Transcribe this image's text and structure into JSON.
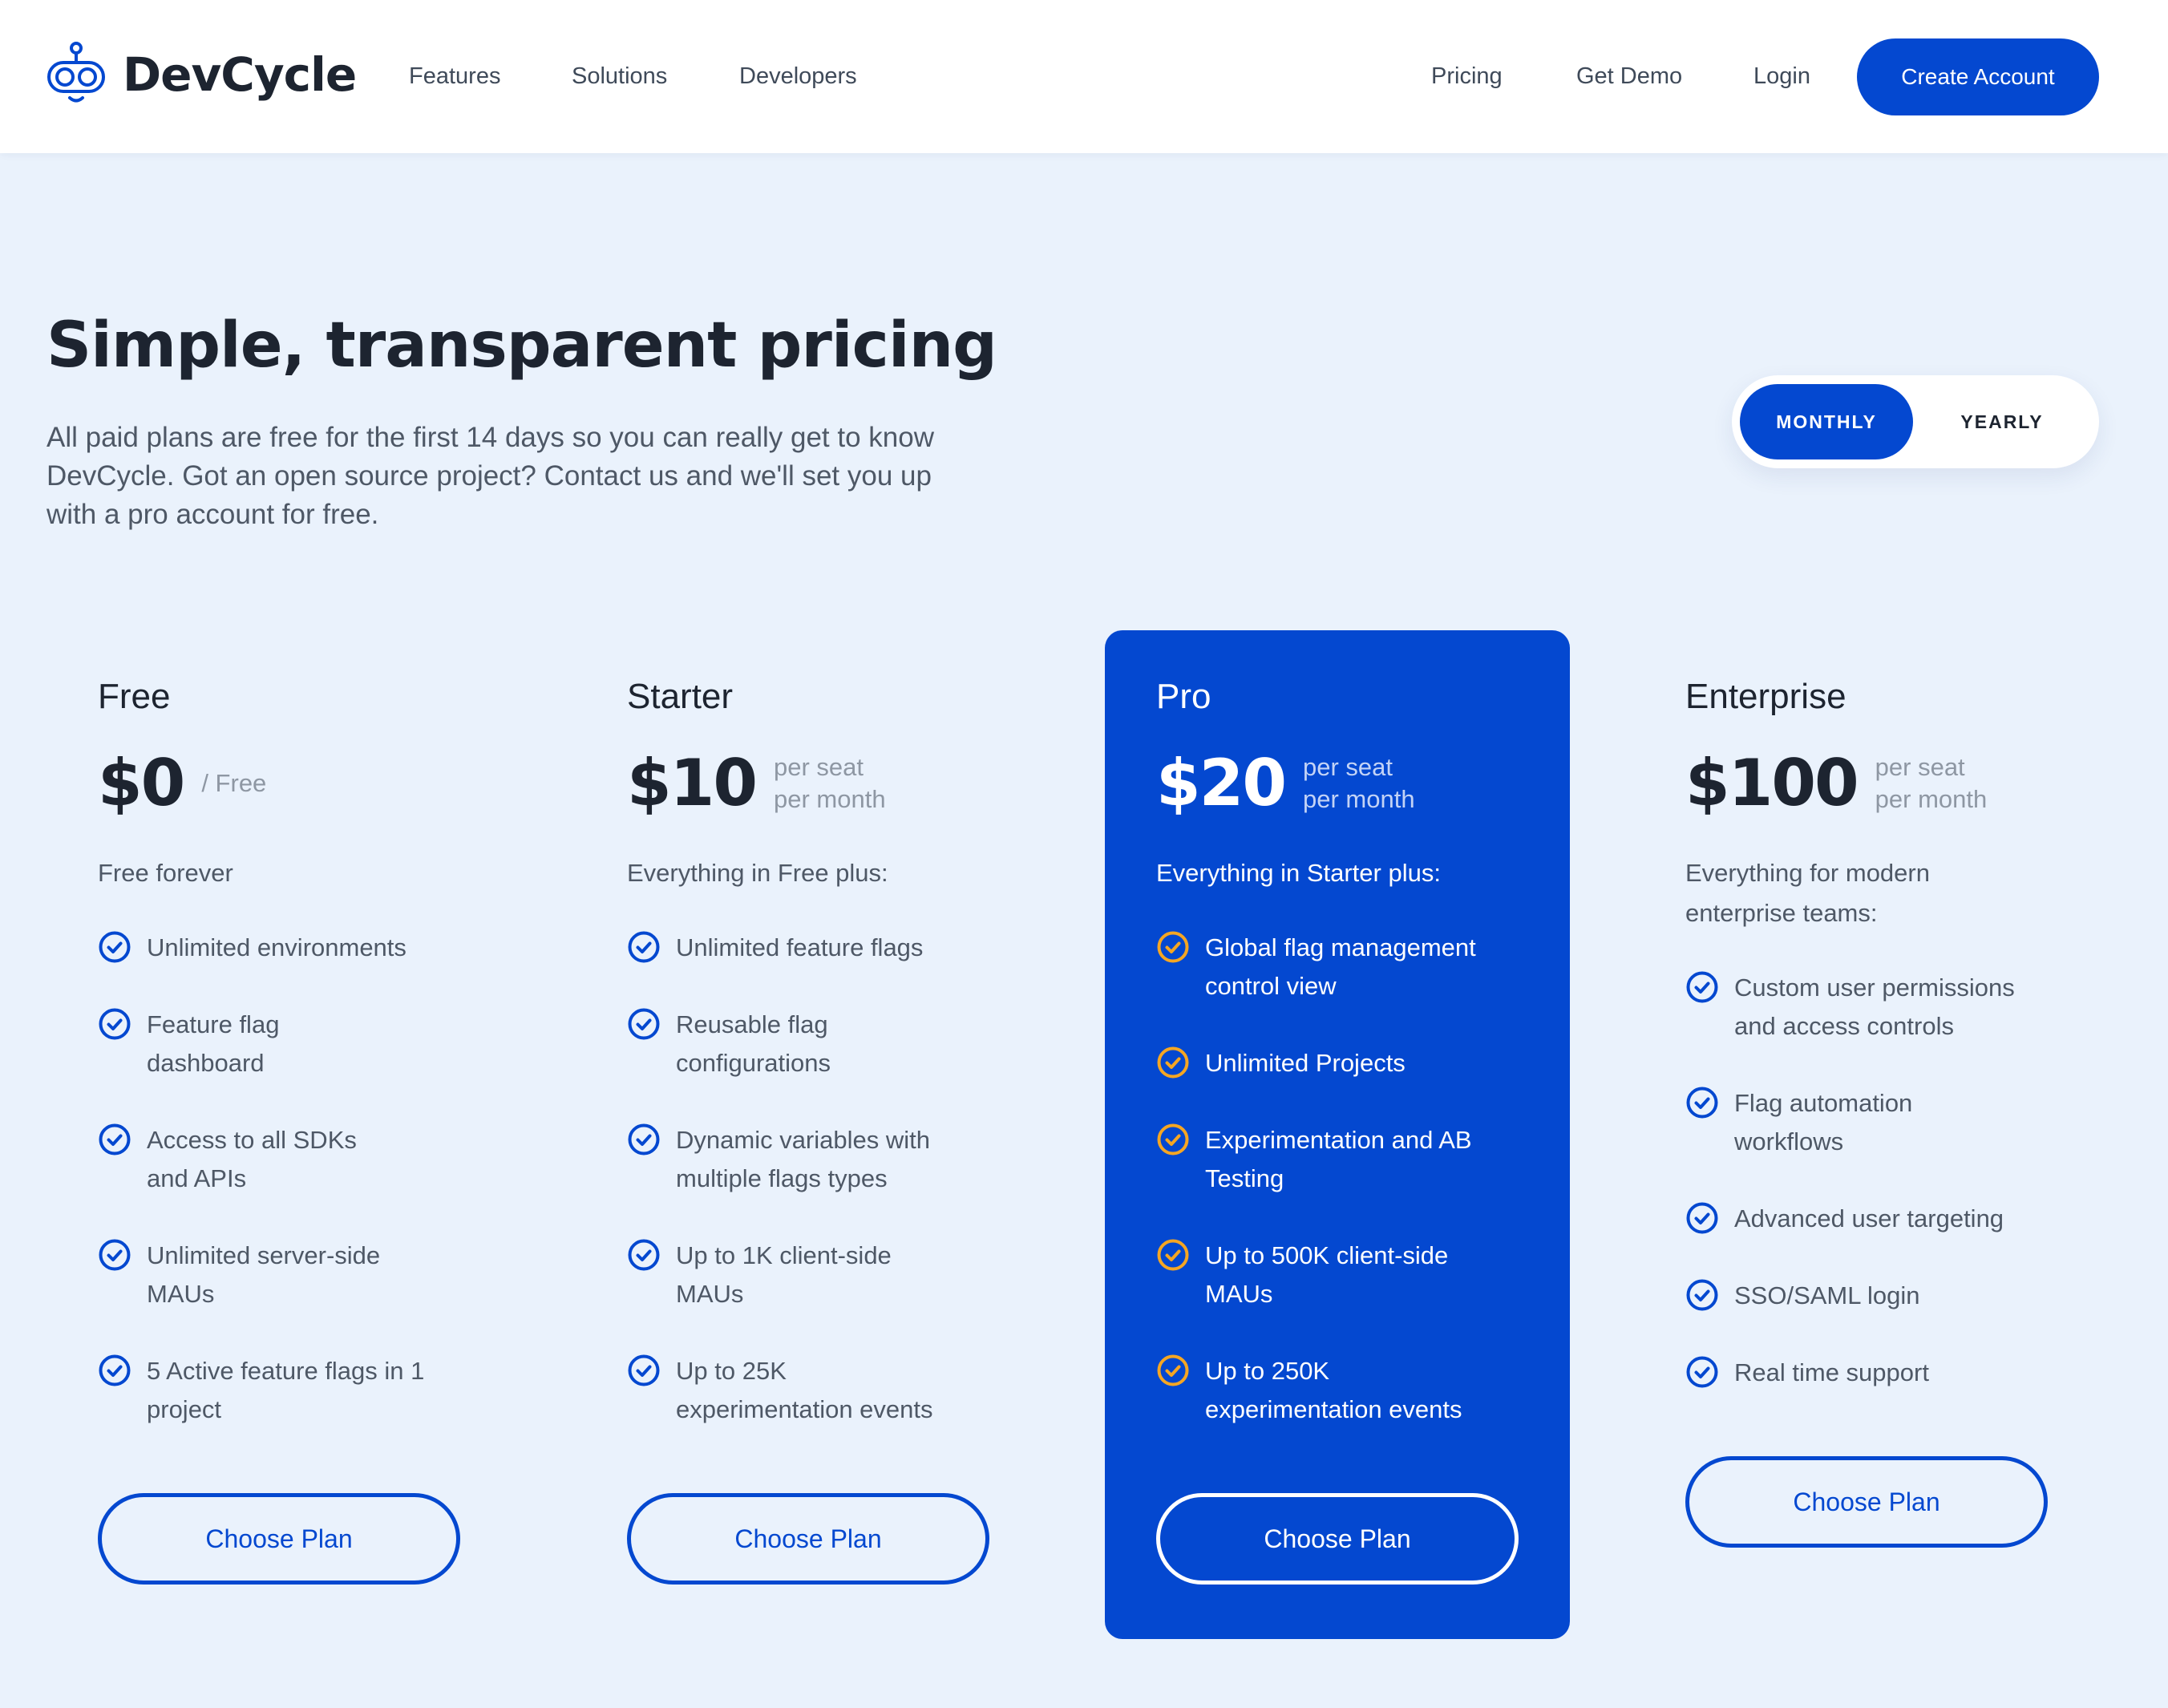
{
  "brand": {
    "name": "DevCycle",
    "logo_icon": "robot-face-logo-icon"
  },
  "nav": {
    "left": [
      "Features",
      "Solutions",
      "Developers"
    ],
    "right": [
      "Pricing",
      "Get Demo",
      "Login"
    ],
    "cta": "Create Account"
  },
  "hero": {
    "title": "Simple, transparent pricing",
    "subtitle_lines": [
      "All paid plans are free for the first 14 days so you can really get to know",
      "DevCycle. Got an open source project? Contact us and we'll set you up",
      "with a pro account for free."
    ]
  },
  "billing_toggle": {
    "options": [
      "MONTHLY",
      "YEARLY"
    ],
    "selected": "MONTHLY"
  },
  "plans": [
    {
      "name": "Free",
      "price": "$0",
      "price_unit": [
        "/ Free"
      ],
      "description": [
        "Free forever"
      ],
      "features": [
        [
          "Unlimited environments"
        ],
        [
          "Feature flag",
          "dashboard"
        ],
        [
          "Access to all SDKs",
          "and APIs"
        ],
        [
          "Unlimited server-side",
          "MAUs"
        ],
        [
          "5 Active feature flags in 1",
          "project"
        ]
      ],
      "cta": "Choose Plan",
      "featured": false
    },
    {
      "name": "Starter",
      "price": "$10",
      "price_unit": [
        "per seat",
        "per month"
      ],
      "description": [
        "Everything in Free plus:"
      ],
      "features": [
        [
          "Unlimited feature flags"
        ],
        [
          "Reusable flag",
          "configurations"
        ],
        [
          "Dynamic variables with",
          "multiple flags types"
        ],
        [
          "Up to 1K client-side",
          "MAUs"
        ],
        [
          "Up to 25K",
          "experimentation events"
        ]
      ],
      "cta": "Choose Plan",
      "featured": false
    },
    {
      "name": "Pro",
      "price": "$20",
      "price_unit": [
        "per seat",
        "per month"
      ],
      "description": [
        "Everything in Starter plus:"
      ],
      "features": [
        [
          "Global flag management",
          "control view"
        ],
        [
          "Unlimited Projects"
        ],
        [
          "Experimentation and AB",
          "Testing"
        ],
        [
          "Up to 500K client-side",
          "MAUs"
        ],
        [
          "Up to 250K",
          "experimentation events"
        ]
      ],
      "cta": "Choose Plan",
      "featured": true
    },
    {
      "name": "Enterprise",
      "price": "$100",
      "price_unit": [
        "per seat",
        "per month"
      ],
      "description": [
        "Everything for modern",
        "enterprise teams:"
      ],
      "features": [
        [
          "Custom user permissions",
          "and access controls"
        ],
        [
          "Flag automation",
          "workflows"
        ],
        [
          "Advanced user targeting"
        ],
        [
          "SSO/SAML login"
        ],
        [
          "Real time support"
        ]
      ],
      "cta": "Choose Plan",
      "featured": false
    }
  ],
  "icons": {
    "feature_check": "check-circle-icon"
  },
  "colors": {
    "primary": "#0448d0",
    "page_background": "#eaf2fc",
    "heading": "#1d2430",
    "body_text": "#4e5866",
    "check_standard": "#0448d0",
    "check_featured": "#f5a623"
  }
}
